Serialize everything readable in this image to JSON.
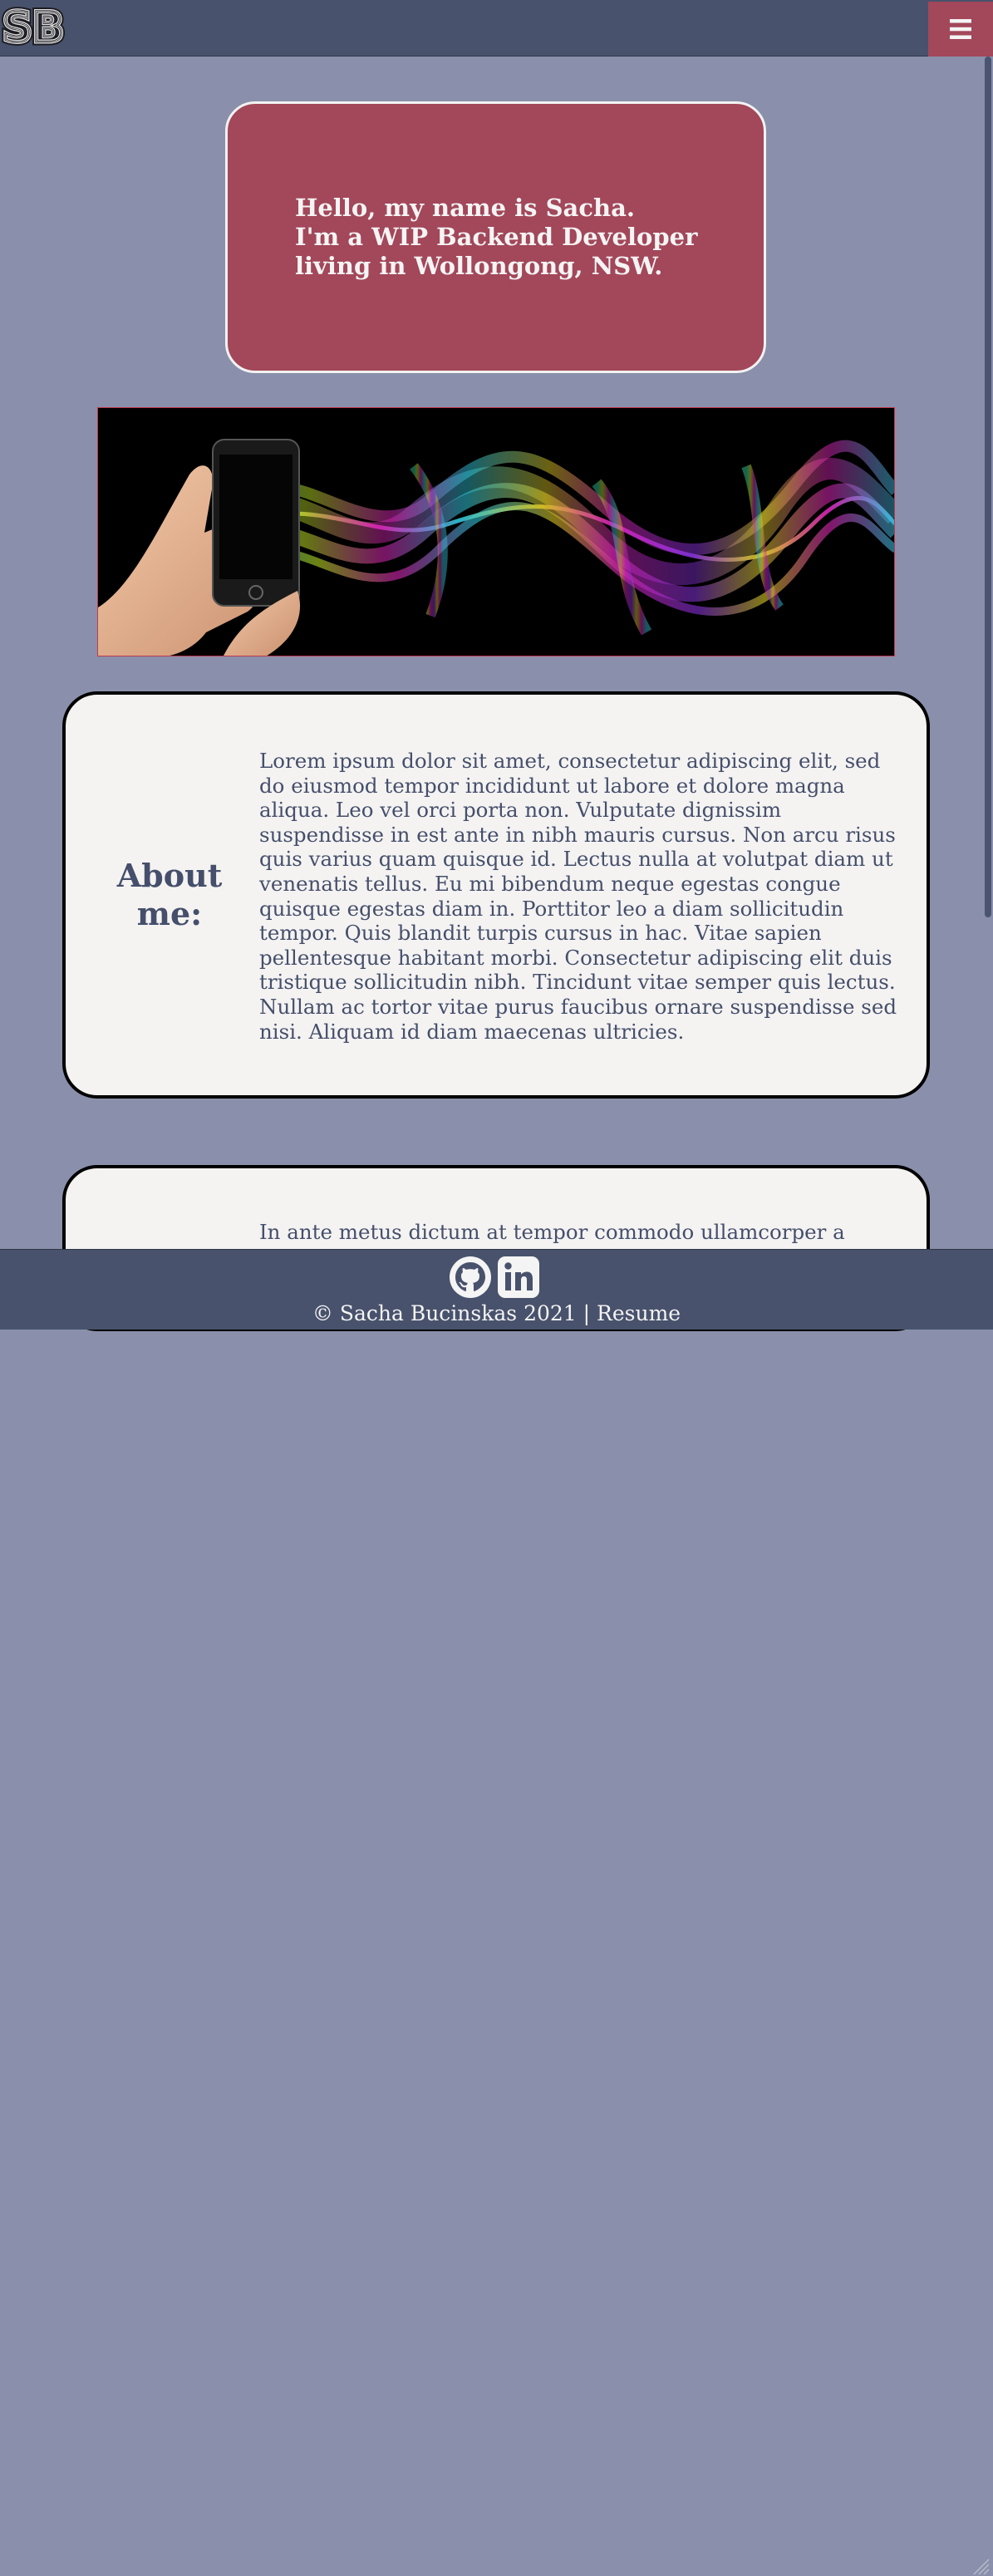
{
  "header": {
    "logo_text": "SB",
    "menu_icon": "hamburger-menu-icon"
  },
  "intro": {
    "lines": [
      "Hello, my name is Sacha.",
      "I'm a WIP Backend Developer",
      "living in Wollongong, NSW."
    ]
  },
  "hero": {
    "image": "hand-holding-phone-with-rainbow-wave"
  },
  "about": {
    "heading": "About me:",
    "text": "Lorem ipsum dolor sit amet, consectetur adipiscing elit, sed do eiusmod tempor incididunt ut labore et dolore magna aliqua. Leo vel orci porta non. Vulputate dignissim suspendisse in est ante in nibh mauris cursus. Non arcu risus quis varius quam quisque id. Lectus nulla at volutpat diam ut venenatis tellus. Eu mi bibendum neque egestas congue quisque egestas diam in. Porttitor leo a diam sollicitudin tempor. Quis blandit turpis cursus in hac. Vitae sapien pellentesque habitant morbi. Consectetur adipiscing elit duis tristique sollicitudin nibh. Tincidunt vitae semper quis lectus. Nullam ac tortor vitae purus faucibus ornare suspendisse sed nisi. Aliquam id diam maecenas ultricies."
  },
  "second_section": {
    "text": "In ante metus dictum at tempor commodo ullamcorper a"
  },
  "footer": {
    "icons": [
      "github-icon",
      "linkedin-icon"
    ],
    "copyright": "© Sacha Bucinskas 2021 |",
    "resume_link": "Resume"
  },
  "colors": {
    "page_background": "#8a90ab",
    "header_background": "#48526c",
    "accent": "#a3475a",
    "card_background": "#f4f3f2",
    "text_dark": "#454f6b"
  }
}
